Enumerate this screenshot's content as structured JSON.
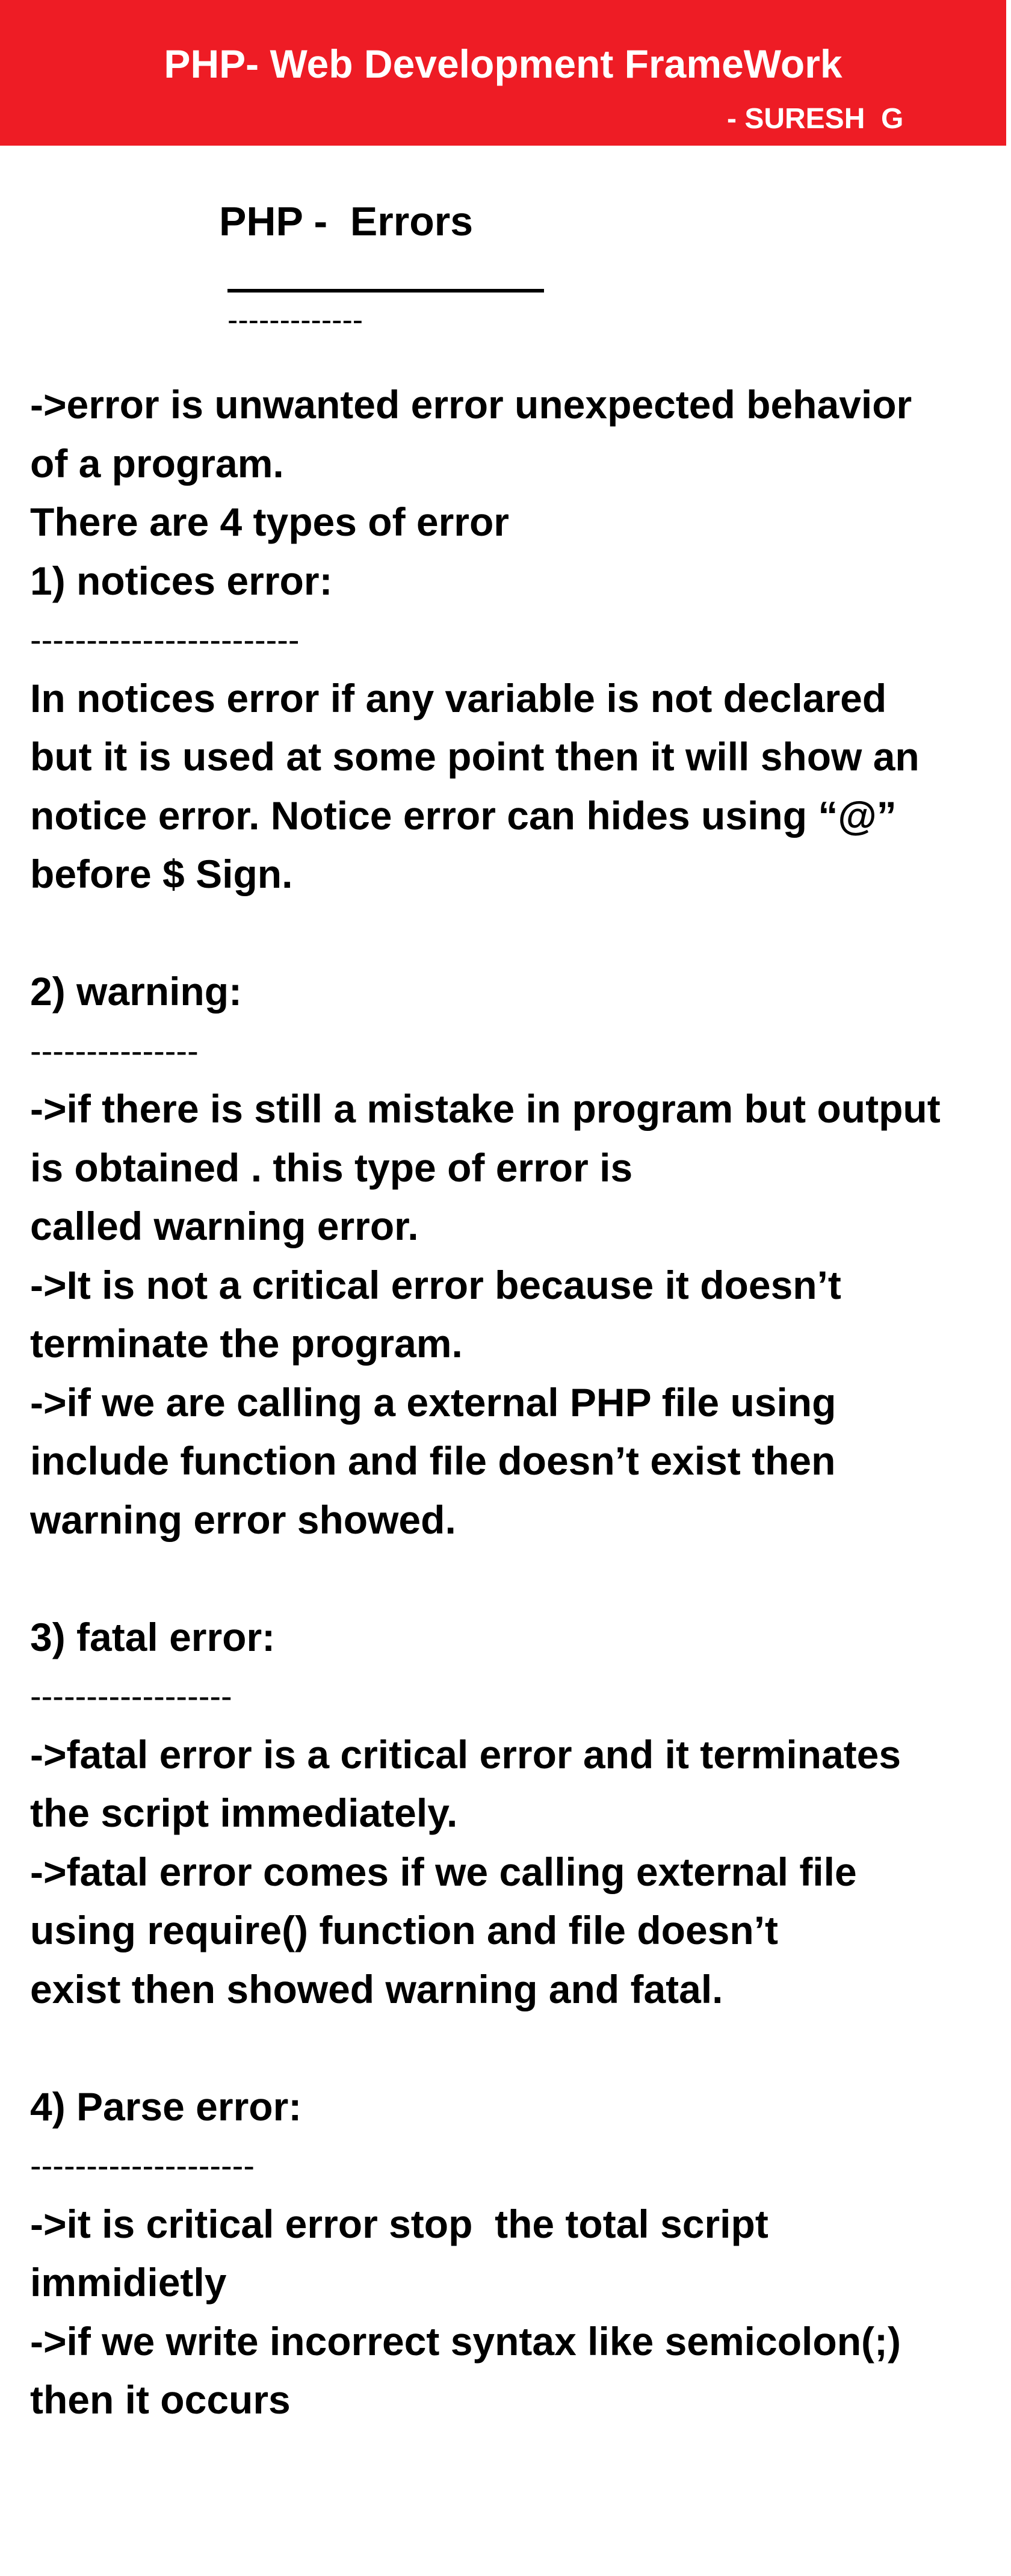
{
  "header": {
    "title": "PHP- Web Development FrameWork",
    "author": "- SURESH  G",
    "bg_color": "#ee1c25",
    "text_color": "#ffffff"
  },
  "page": {
    "title": "PHP -  Errors",
    "title_dashes": "-------------"
  },
  "intro": {
    "line1": "->error is unwanted error unexpected behavior",
    "line2": "of a program.",
    "line3": "There are 4 types of error"
  },
  "sections": [
    {
      "heading": "1) notices error:",
      "dashes": "------------------------",
      "lines": [
        "In notices error if any variable is not declared",
        "but it is used at some point then it will show an",
        "notice error. Notice error can hides using “@”",
        "before $ Sign."
      ]
    },
    {
      "heading": "2) warning:",
      "dashes": "---------------",
      "lines": [
        "->if there is still a mistake in program but output",
        "is obtained . this type of error is",
        "called warning error.",
        "->It is not a critical error because it doesn’t",
        "terminate the program.",
        "->if we are calling a external PHP file using",
        "include function and file doesn’t exist then",
        "warning error showed."
      ]
    },
    {
      "heading": "3) fatal error:",
      "dashes": "------------------",
      "lines": [
        "->fatal error is a critical error and it terminates",
        "the script immediately.",
        "->fatal error comes if we calling external file",
        "using require() function and file doesn’t",
        "exist then showed warning and fatal."
      ]
    },
    {
      "heading": "4) Parse error:",
      "dashes": "--------------------",
      "lines": [
        "->it is critical error stop  the total script",
        "immidietly",
        "->if we write incorrect syntax like semicolon(;)",
        "then it occurs"
      ]
    }
  ]
}
